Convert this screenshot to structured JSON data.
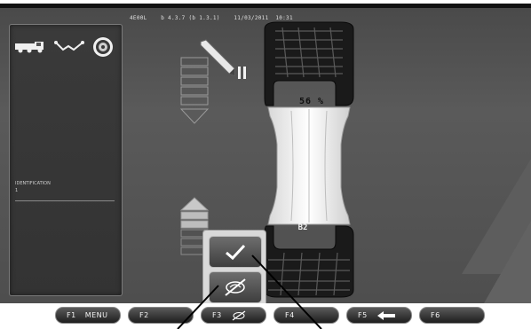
{
  "status_bar": {
    "text": "4E00L    b 4.3.7 (b 1.3.1)    11/03/2011  10:31"
  },
  "left_panel": {
    "label": "IDENTIFICATION",
    "sub_label": "1",
    "icons": [
      "truck-icon",
      "alignment-icon",
      "wheel-icon"
    ]
  },
  "wheel": {
    "upper_value": "56 %",
    "lower_label": "B2"
  },
  "popup": {
    "confirm_icon": "checkmark-icon",
    "cancel_icon": "crossed-wheel-icon"
  },
  "function_keys": [
    {
      "key": "F1",
      "label": "MENU"
    },
    {
      "key": "F2",
      "label": ""
    },
    {
      "key": "F3",
      "label": "",
      "icon": "crossed-wheel-icon"
    },
    {
      "key": "F4",
      "label": ""
    },
    {
      "key": "F5",
      "label": "",
      "icon": "back-arrow-icon"
    },
    {
      "key": "F6",
      "label": ""
    }
  ],
  "colors": {
    "background": "#4e4e4e",
    "panel": "#333333",
    "popup": "#d9d9d9",
    "tire": "#1a1a1a",
    "rim": "#f0f0f0"
  }
}
